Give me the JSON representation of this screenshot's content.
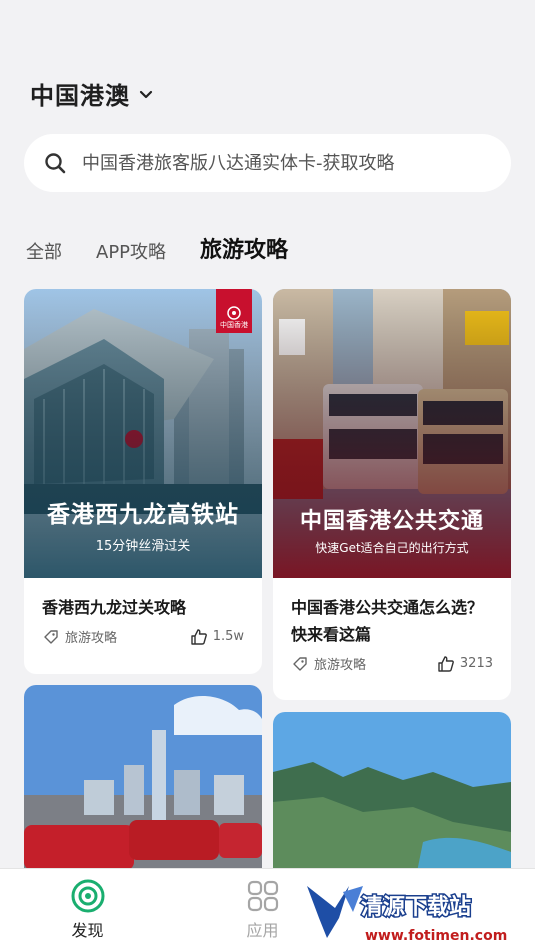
{
  "region": {
    "title": "中国港澳",
    "icon": "chevron-down-icon"
  },
  "search": {
    "placeholder": "中国香港旅客版八达通实体卡-获取攻略",
    "icon": "search-icon"
  },
  "tabs": [
    {
      "label": "全部",
      "active": false
    },
    {
      "label": "APP攻略",
      "active": false
    },
    {
      "label": "旅游攻略",
      "active": true
    }
  ],
  "cards": [
    {
      "title": "香港西九龙过关攻略",
      "overlay_title": "香港西九龙高铁站",
      "overlay_sub": "15分钟丝滑过关",
      "badge": "中国香港",
      "tag": "旅游攻略",
      "likes": "1.5w"
    },
    {
      "title": "中国香港公共交通怎么选？快来看这篇",
      "overlay_title": "中国香港公共交通",
      "overlay_sub": "快速Get适合自己的出行方式",
      "tag": "旅游攻略",
      "likes": "3213"
    },
    {
      "title": "",
      "tag": "",
      "likes": ""
    },
    {
      "title": "",
      "tag": "",
      "likes": ""
    }
  ],
  "bottom_nav": [
    {
      "label": "发现",
      "icon": "discover-icon",
      "active": true
    },
    {
      "label": "应用",
      "icon": "apps-grid-icon",
      "active": false
    }
  ],
  "watermark": {
    "text": "清源下载站",
    "url": "www.fotimen.com",
    "site": "Qy"
  },
  "colors": {
    "background": "#f2f2f4",
    "accent": "#1aae6f",
    "hk_red": "#c8102e"
  }
}
